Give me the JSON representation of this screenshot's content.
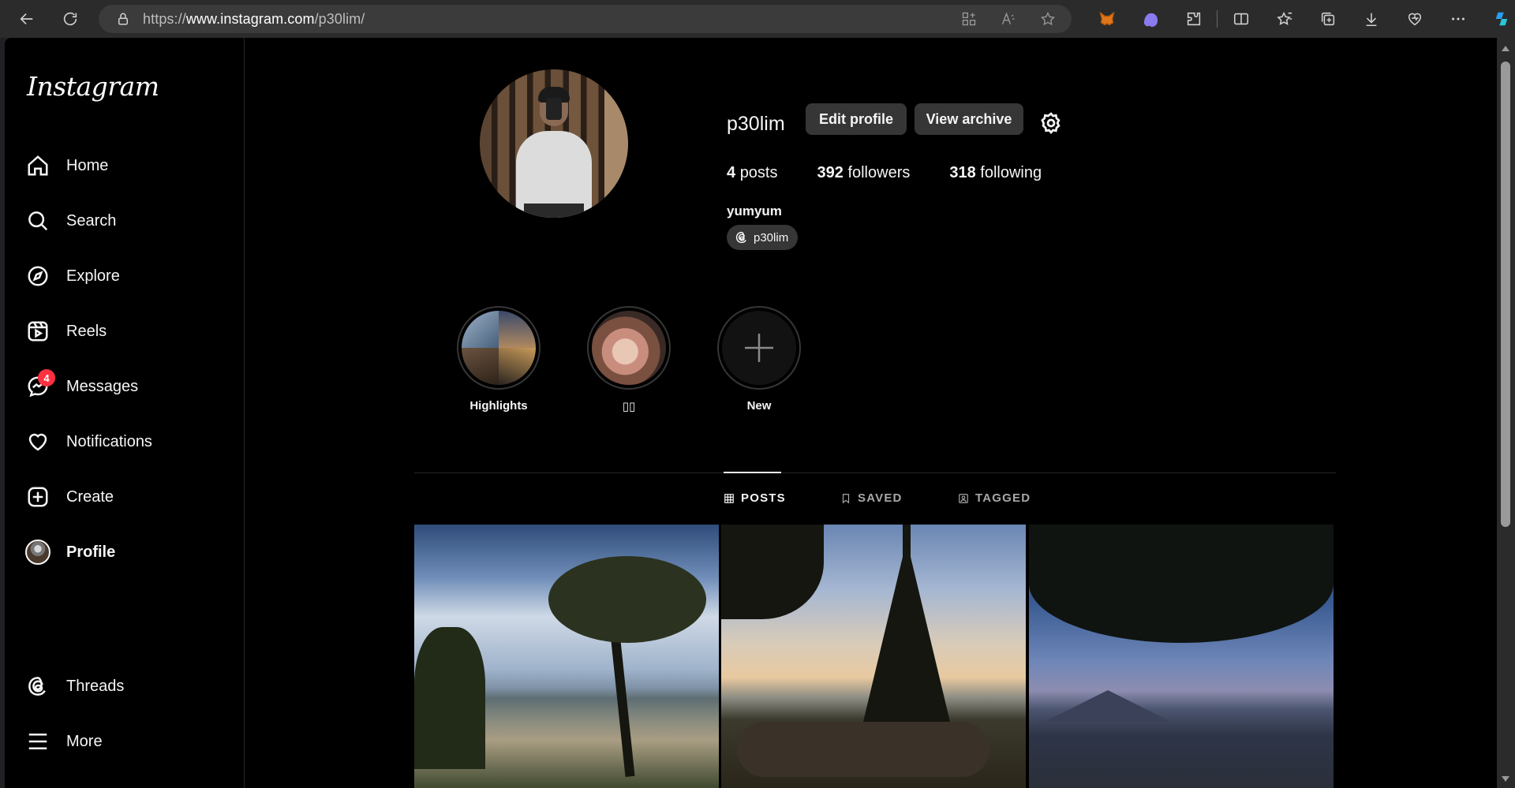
{
  "browser": {
    "url_prefix": "https://",
    "url_domain": "www.instagram.com",
    "url_path": "/p30lim/"
  },
  "sidebar": {
    "logo": "Instagram",
    "items": [
      {
        "label": "Home",
        "icon": "home-icon"
      },
      {
        "label": "Search",
        "icon": "search-icon"
      },
      {
        "label": "Explore",
        "icon": "compass-icon"
      },
      {
        "label": "Reels",
        "icon": "reels-icon"
      },
      {
        "label": "Messages",
        "icon": "messenger-icon",
        "badge": "4"
      },
      {
        "label": "Notifications",
        "icon": "heart-icon"
      },
      {
        "label": "Create",
        "icon": "plus-square-icon"
      },
      {
        "label": "Profile",
        "icon": "avatar"
      }
    ],
    "bottom_items": [
      {
        "label": "Threads",
        "icon": "threads-icon"
      },
      {
        "label": "More",
        "icon": "menu-icon"
      }
    ]
  },
  "profile": {
    "username": "p30lim",
    "edit_label": "Edit profile",
    "archive_label": "View archive",
    "posts_count": "4",
    "posts_label": "posts",
    "followers_count": "392",
    "followers_label": "followers",
    "following_count": "318",
    "following_label": "following",
    "full_name": "yumyum",
    "threads_handle": "p30lim"
  },
  "highlights": [
    {
      "label": "Highlights"
    },
    {
      "label": "▯▯"
    },
    {
      "label": "New"
    }
  ],
  "tabs": [
    {
      "label": "POSTS",
      "active": true
    },
    {
      "label": "SAVED",
      "active": false
    },
    {
      "label": "TAGGED",
      "active": false
    }
  ],
  "colors": {
    "background": "#000000",
    "button": "#363636",
    "badge": "#ff3040",
    "muted_text": "#a8a8a8"
  }
}
